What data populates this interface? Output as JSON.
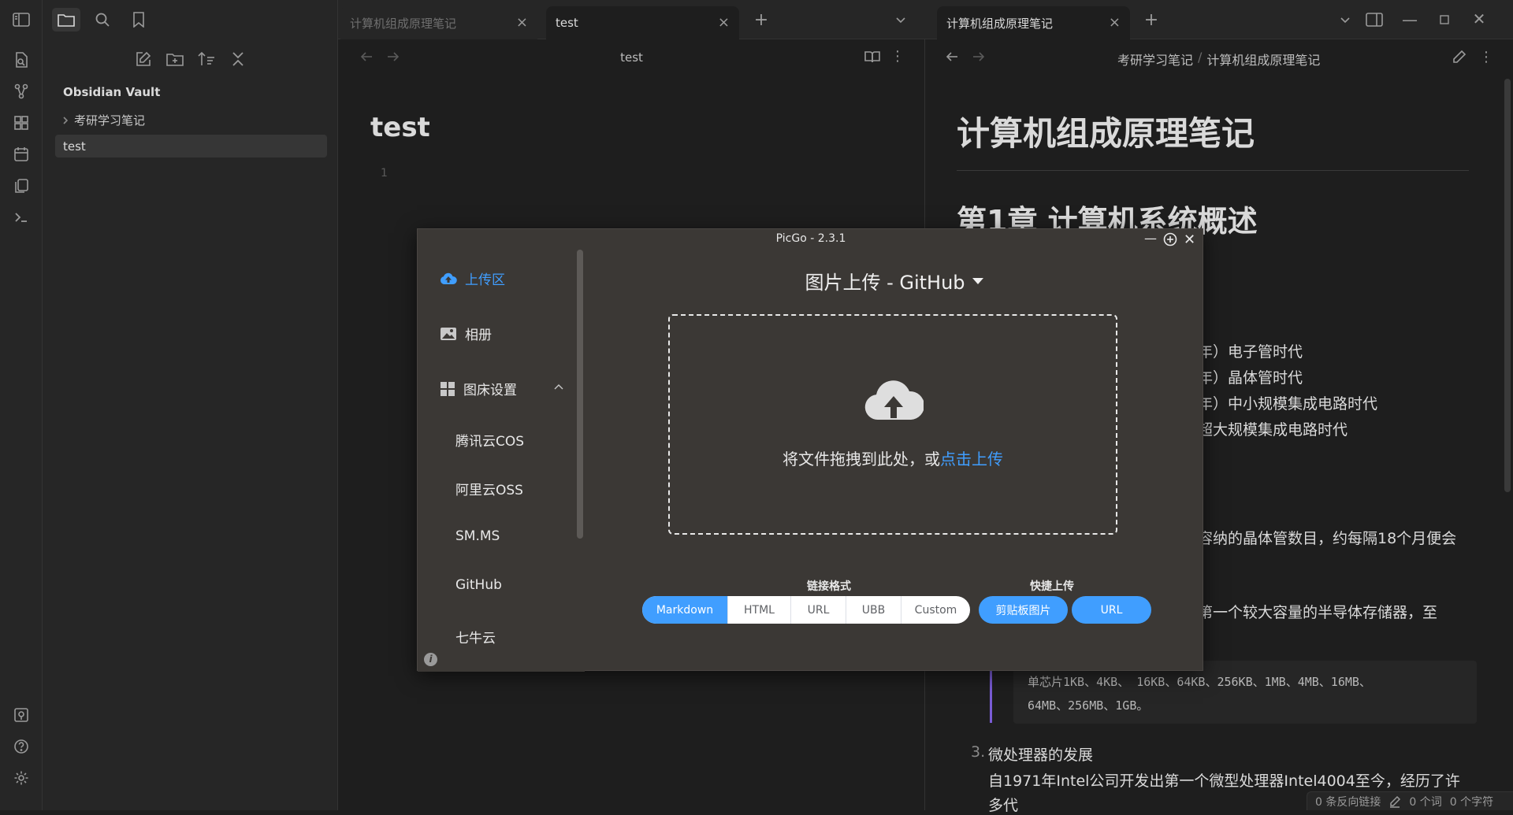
{
  "sidebar": {
    "vault_name": "Obsidian Vault",
    "tree": [
      {
        "label": "考研学习笔记",
        "type": "folder"
      },
      {
        "label": "test",
        "type": "file"
      }
    ]
  },
  "left_pane": {
    "tabs": [
      {
        "label": "计算机组成原理笔记"
      },
      {
        "label": "test"
      }
    ],
    "header_title": "test",
    "doc_title": "test",
    "line_number": "1"
  },
  "right_pane": {
    "tabs": [
      {
        "label": "计算机组成原理笔记"
      }
    ],
    "breadcrumb": [
      "考研学习笔记",
      "计算机组成原理笔记"
    ],
    "breadcrumb_sep": "/",
    "h1": "计算机组成原理笔记",
    "h2": "第1章 计算机系统概述",
    "lines": [
      "年）电子管时代",
      "年）晶体管时代",
      "年）中小规模集成电路时代",
      "超大规模集成电路时代",
      "容纳的晶体管数目，约每隔18个月便会",
      "第一个较大容量的半导体存储器，至"
    ],
    "code_line1": "单芯片1KB、4KB、 16KB、64KB、256KB、1MB、4MB、16MB、",
    "code_line2": "64MB、256MB、1GB。",
    "list_num": "3.",
    "list_item": "微处理器的发展",
    "para": "自1971年Intel公司开发出第一个微型处理器Intel4004至今，经历了许",
    "para2": "多代"
  },
  "status": {
    "backlinks": "0 条反向链接",
    "words": "0 个词",
    "chars": "0 个字符"
  },
  "picgo": {
    "title": "PicGo - 2.3.1",
    "menu": [
      {
        "label": "上传区",
        "active": true
      },
      {
        "label": "相册"
      },
      {
        "label": "图床设置"
      }
    ],
    "submenu": [
      "腾讯云COS",
      "阿里云OSS",
      "SM.MS",
      "GitHub",
      "七牛云"
    ],
    "upload_title": "图片上传 - GitHub",
    "drop_text": "将文件拖拽到此处，或",
    "drop_link": "点击上传",
    "link_format_label": "链接格式",
    "formats": [
      "Markdown",
      "HTML",
      "URL",
      "UBB",
      "Custom"
    ],
    "active_format": "Markdown",
    "quick_label": "快捷上传",
    "quick_buttons": [
      "剪贴板图片",
      "URL"
    ],
    "accent": "#409eff"
  }
}
